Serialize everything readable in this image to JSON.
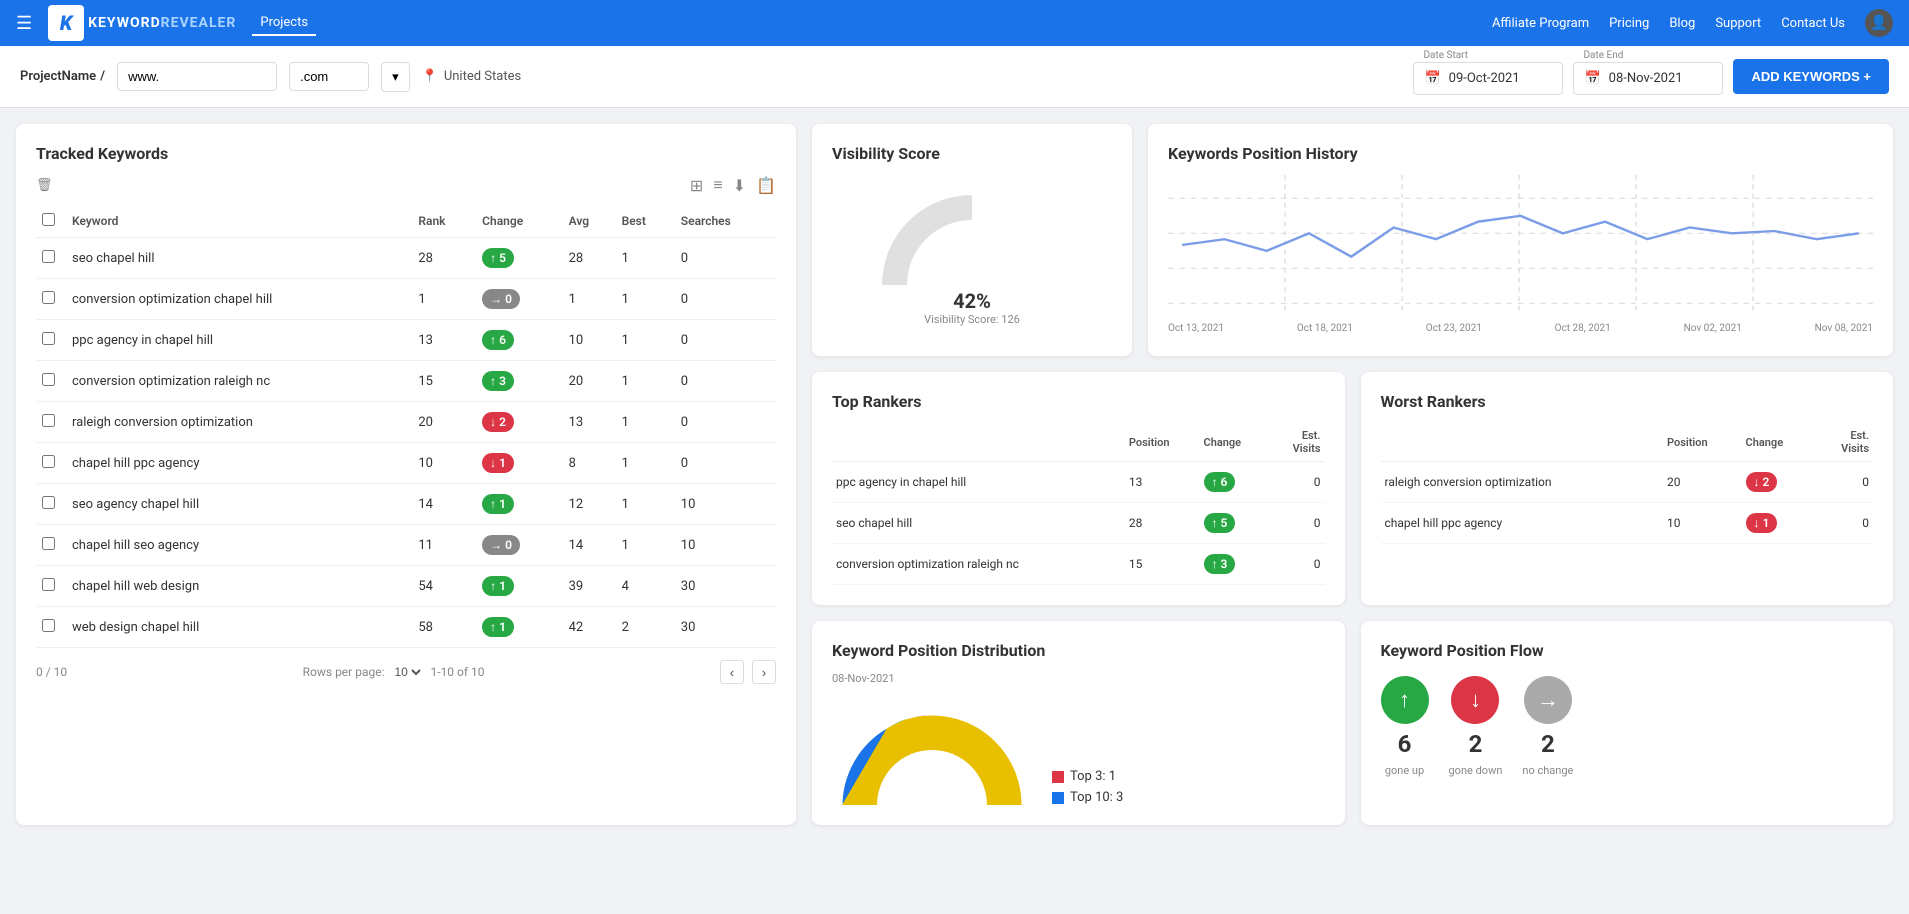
{
  "header": {
    "hamburger": "☰",
    "logo_k": "K",
    "logo_text_1": "KEYWORD",
    "logo_text_2": "REVEALER",
    "nav_projects": "Projects",
    "nav_affiliate": "Affiliate Program",
    "nav_pricing": "Pricing",
    "nav_blog": "Blog",
    "nav_support": "Support",
    "nav_contact": "Contact Us"
  },
  "toolbar": {
    "project_label": "ProjectName",
    "slash": "/",
    "url_prefix": "www.",
    "url_suffix": ".com",
    "location": "United States",
    "date_start_label": "Date Start",
    "date_start": "09-Oct-2021",
    "date_end_label": "Date End",
    "date_end": "08-Nov-2021",
    "add_keywords_btn": "ADD KEYWORDS +"
  },
  "tracked_keywords": {
    "title": "Tracked Keywords",
    "columns": [
      "Keyword",
      "Rank",
      "Change",
      "Avg",
      "Best",
      "Searches"
    ],
    "rows": [
      {
        "keyword": "seo chapel hill",
        "rank": 28,
        "change": 5,
        "change_dir": "up",
        "avg": 28,
        "best": 1,
        "searches": 0
      },
      {
        "keyword": "conversion optimization chapel hill",
        "rank": 1,
        "change": 0,
        "change_dir": "neutral",
        "avg": 1,
        "best": 1,
        "searches": 0
      },
      {
        "keyword": "ppc agency in chapel hill",
        "rank": 13,
        "change": 6,
        "change_dir": "up",
        "avg": 10,
        "best": 1,
        "searches": 0
      },
      {
        "keyword": "conversion optimization raleigh nc",
        "rank": 15,
        "change": 3,
        "change_dir": "up",
        "avg": 20,
        "best": 1,
        "searches": 0
      },
      {
        "keyword": "raleigh conversion optimization",
        "rank": 20,
        "change": 2,
        "change_dir": "down",
        "avg": 13,
        "best": 1,
        "searches": 0
      },
      {
        "keyword": "chapel hill ppc agency",
        "rank": 10,
        "change": 1,
        "change_dir": "down",
        "avg": 8,
        "best": 1,
        "searches": 0
      },
      {
        "keyword": "seo agency chapel hill",
        "rank": 14,
        "change": 1,
        "change_dir": "up",
        "avg": 12,
        "best": 1,
        "searches": 10
      },
      {
        "keyword": "chapel hill seo agency",
        "rank": 11,
        "change": 0,
        "change_dir": "neutral",
        "avg": 14,
        "best": 1,
        "searches": 10
      },
      {
        "keyword": "chapel hill web design",
        "rank": 54,
        "change": 1,
        "change_dir": "up",
        "avg": 39,
        "best": 4,
        "searches": 30
      },
      {
        "keyword": "web design chapel hill",
        "rank": 58,
        "change": 1,
        "change_dir": "up",
        "avg": 42,
        "best": 2,
        "searches": 30
      }
    ],
    "pagination_count": "0 / 10",
    "rows_per_page_label": "Rows per page:",
    "rows_per_page_value": "10",
    "page_info": "1-10 of 10"
  },
  "visibility": {
    "title": "Visibility Score",
    "percent": "42%",
    "label": "Visibility Score: 126"
  },
  "position_history": {
    "title": "Keywords Position History",
    "x_labels": [
      "Oct 13, 2021",
      "Oct 18, 2021",
      "Oct 23, 2021",
      "Oct 28, 2021",
      "Nov 02, 2021",
      "Nov 08, 2021"
    ]
  },
  "top_rankers": {
    "title": "Top Rankers",
    "col_position": "Position",
    "col_change": "Change",
    "col_est_visits": "Est. Visits",
    "rows": [
      {
        "keyword": "ppc agency in chapel hill",
        "position": 13,
        "change": 6,
        "change_dir": "up",
        "est_visits": 0
      },
      {
        "keyword": "seo chapel hill",
        "position": 28,
        "change": 5,
        "change_dir": "up",
        "est_visits": 0
      },
      {
        "keyword": "conversion optimization raleigh nc",
        "position": 15,
        "change": 3,
        "change_dir": "up",
        "est_visits": 0
      }
    ]
  },
  "worst_rankers": {
    "title": "Worst Rankers",
    "col_position": "Position",
    "col_change": "Change",
    "col_est_visits": "Est. Visits",
    "rows": [
      {
        "keyword": "raleigh conversion optimization",
        "position": 20,
        "change": 2,
        "change_dir": "down",
        "est_visits": 0
      },
      {
        "keyword": "chapel hill ppc agency",
        "position": 10,
        "change": 1,
        "change_dir": "down",
        "est_visits": 0
      }
    ]
  },
  "distribution": {
    "title": "Keyword Position Distribution",
    "date": "08-Nov-2021",
    "legend": [
      {
        "label": "Top 3: 1",
        "color": "#dc3545"
      },
      {
        "label": "Top 10: 3",
        "color": "#1a73e8"
      }
    ]
  },
  "flow": {
    "title": "Keyword Position Flow",
    "items": [
      {
        "value": "6",
        "label": "gone up",
        "dir": "up",
        "color": "green"
      },
      {
        "value": "2",
        "label": "gone down",
        "dir": "down",
        "color": "red"
      },
      {
        "value": "2",
        "label": "no change",
        "dir": "neutral",
        "color": "gray"
      }
    ]
  }
}
